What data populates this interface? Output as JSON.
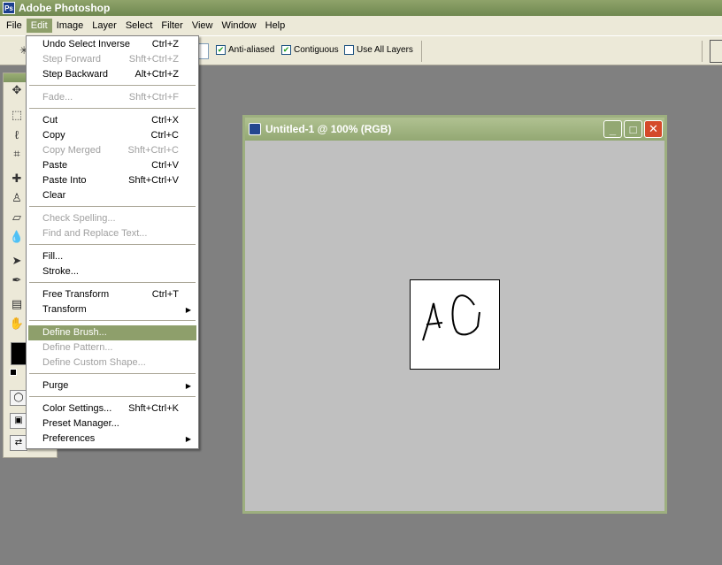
{
  "app": {
    "title": "Adobe Photoshop",
    "logo_text": "Ps"
  },
  "menubar": [
    "File",
    "Edit",
    "Image",
    "Layer",
    "Select",
    "Filter",
    "View",
    "Window",
    "Help"
  ],
  "options": {
    "anti_aliased": {
      "label": "Anti-aliased",
      "checked": true
    },
    "contiguous": {
      "label": "Contiguous",
      "checked": true
    },
    "use_all_layers": {
      "label": "Use All Layers",
      "checked": false
    }
  },
  "edit_menu": {
    "undo": {
      "label": "Undo Select Inverse",
      "shortcut": "Ctrl+Z"
    },
    "step_forward": {
      "label": "Step Forward",
      "shortcut": "Shft+Ctrl+Z"
    },
    "step_backward": {
      "label": "Step Backward",
      "shortcut": "Alt+Ctrl+Z"
    },
    "fade": {
      "label": "Fade...",
      "shortcut": "Shft+Ctrl+F"
    },
    "cut": {
      "label": "Cut",
      "shortcut": "Ctrl+X"
    },
    "copy": {
      "label": "Copy",
      "shortcut": "Ctrl+C"
    },
    "copy_merged": {
      "label": "Copy Merged",
      "shortcut": "Shft+Ctrl+C"
    },
    "paste": {
      "label": "Paste",
      "shortcut": "Ctrl+V"
    },
    "paste_into": {
      "label": "Paste Into",
      "shortcut": "Shft+Ctrl+V"
    },
    "clear": {
      "label": "Clear"
    },
    "check_spelling": {
      "label": "Check Spelling..."
    },
    "find_replace": {
      "label": "Find and Replace Text..."
    },
    "fill": {
      "label": "Fill..."
    },
    "stroke": {
      "label": "Stroke..."
    },
    "free_transform": {
      "label": "Free Transform",
      "shortcut": "Ctrl+T"
    },
    "transform": {
      "label": "Transform"
    },
    "define_brush": {
      "label": "Define Brush..."
    },
    "define_pattern": {
      "label": "Define Pattern..."
    },
    "define_custom_shape": {
      "label": "Define Custom Shape..."
    },
    "purge": {
      "label": "Purge"
    },
    "color_settings": {
      "label": "Color Settings...",
      "shortcut": "Shft+Ctrl+K"
    },
    "preset_manager": {
      "label": "Preset Manager..."
    },
    "preferences": {
      "label": "Preferences"
    }
  },
  "document": {
    "title": "Untitled-1 @ 100% (RGB)"
  },
  "colors": {
    "accent": "#8e9f6b",
    "desktop": "#808080",
    "close_button": "#d44a2a"
  }
}
